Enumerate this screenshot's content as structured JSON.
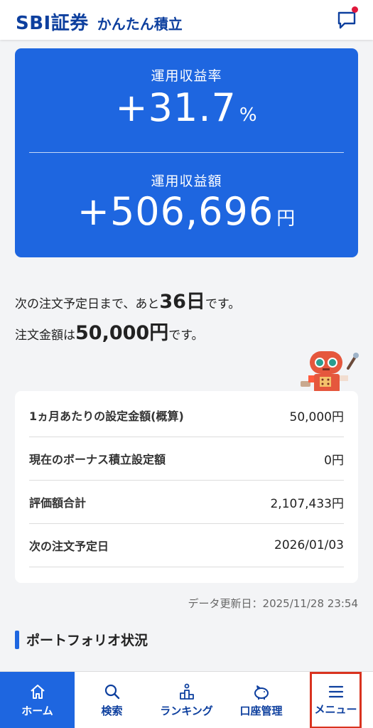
{
  "header": {
    "brand": "SBI証券",
    "subtitle": "かんたん積立",
    "chat_icon": "chat-icon",
    "notification_color": "#e0173b"
  },
  "summary": {
    "rate_label": "運用収益率",
    "rate_value": "+31.7",
    "rate_unit": "%",
    "amount_label": "運用収益額",
    "amount_value": "+506,696",
    "amount_unit": "円",
    "color": "#1e66e0"
  },
  "schedule": {
    "line1_pre": "次の注文予定日まで、あと",
    "days": "36日",
    "line1_post": "です。",
    "line2_pre": "注文金額は",
    "amount": "50,000円",
    "line2_post": "です。"
  },
  "settings": {
    "rows": [
      {
        "label": "1ヵ月あたりの設定金額(概算)",
        "value": "50,000円"
      },
      {
        "label": "現在のボーナス積立設定額",
        "value": "0円"
      },
      {
        "label": "評価額合計",
        "value": "2,107,433円"
      },
      {
        "label": "次の注文予定日",
        "value": "2026/01/03"
      }
    ]
  },
  "updated": "データ更新日：2025/11/28 23:54",
  "section_title": "ポートフォリオ状況",
  "nav": {
    "items": [
      {
        "label": "ホーム",
        "icon": "home-icon"
      },
      {
        "label": "検索",
        "icon": "search-icon"
      },
      {
        "label": "ランキング",
        "icon": "ranking-icon"
      },
      {
        "label": "口座管理",
        "icon": "piggy-bank-icon"
      },
      {
        "label": "メニュー",
        "icon": "menu-icon"
      }
    ]
  }
}
